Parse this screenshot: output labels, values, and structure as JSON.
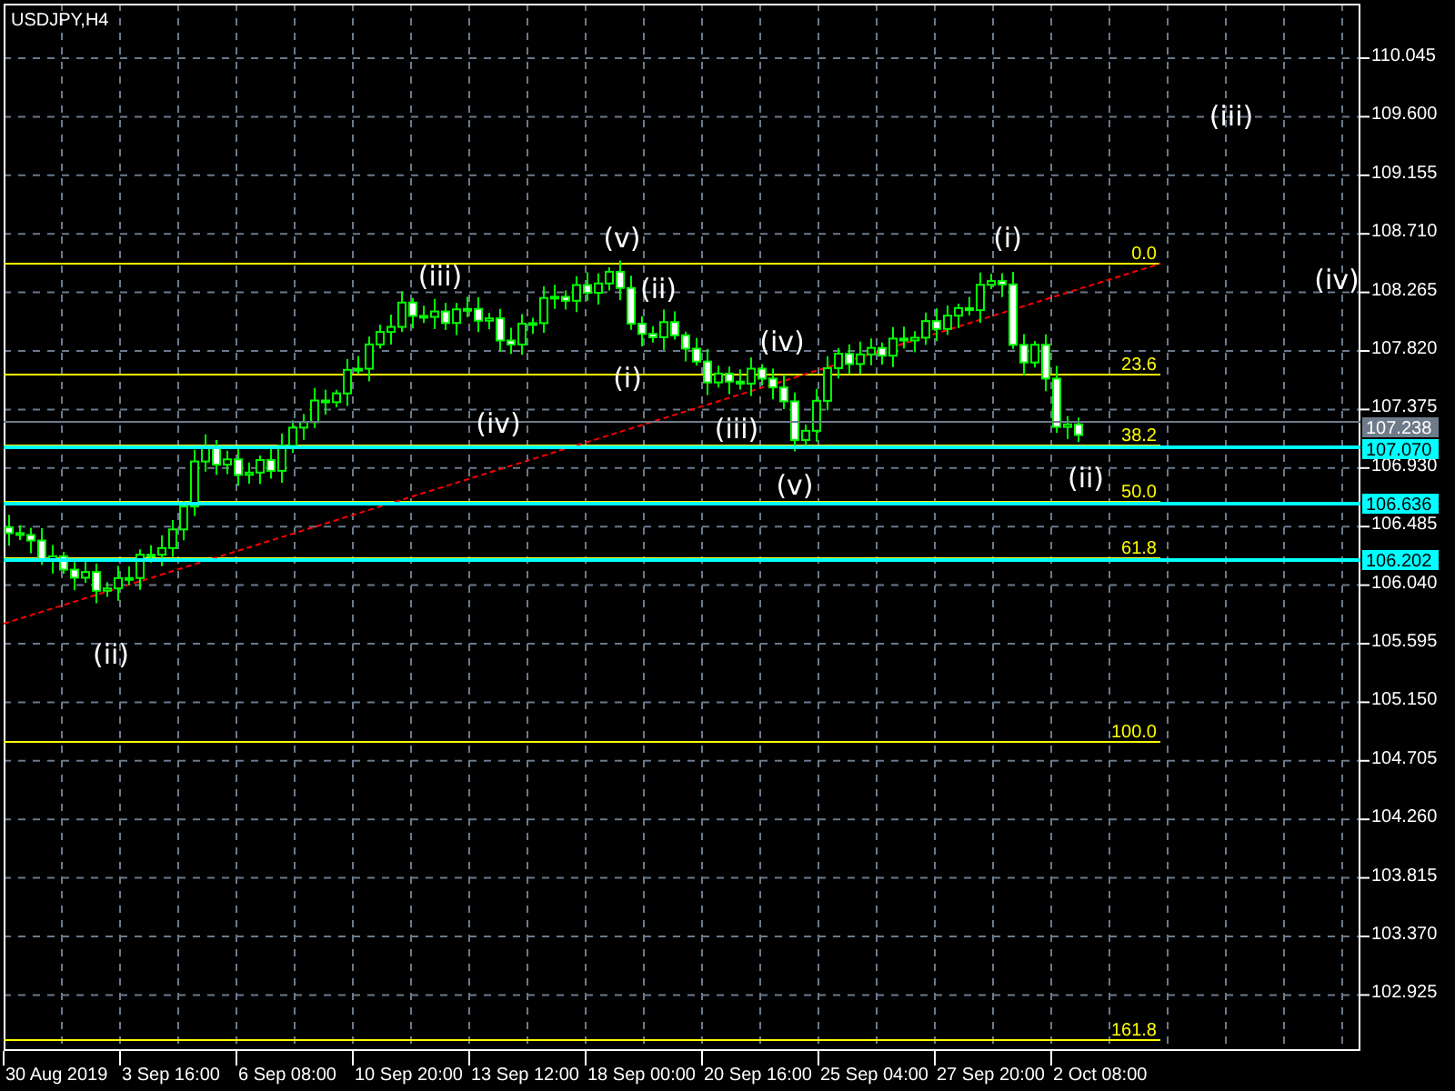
{
  "chart": {
    "title": "USDJPY,H4",
    "price_axis": [
      "110.045",
      "109.600",
      "109.155",
      "108.710",
      "108.265",
      "107.820",
      "107.375",
      "106.930",
      "106.485",
      "106.040",
      "105.595",
      "105.150",
      "104.705",
      "104.260",
      "103.815",
      "103.370",
      "102.925"
    ],
    "time_axis": [
      "30 Aug 2019",
      "3 Sep 16:00",
      "6 Sep 08:00",
      "10 Sep 20:00",
      "13 Sep 12:00",
      "18 Sep 00:00",
      "20 Sep 16:00",
      "25 Sep 04:00",
      "27 Sep 20:00",
      "2 Oct 08:00"
    ],
    "fib_levels": [
      "0.0",
      "23.6",
      "38.2",
      "50.0",
      "61.8",
      "100.0",
      "161.8"
    ],
    "price_tags": [
      {
        "text": "107.238",
        "color": "#6e7b8b"
      },
      {
        "text": "107.070",
        "color": "#00ffff"
      },
      {
        "text": "106.636",
        "color": "#00ffff"
      },
      {
        "text": "106.202",
        "color": "#00ffff"
      }
    ],
    "wave_labels": [
      "(iii)",
      "(iv)",
      "(v)",
      "(iii)",
      "(ii)",
      "(i)",
      "(iv)",
      "(i)",
      "(iv)",
      "(iii)",
      "(v)",
      "(ii)",
      "(ii)"
    ]
  }
}
